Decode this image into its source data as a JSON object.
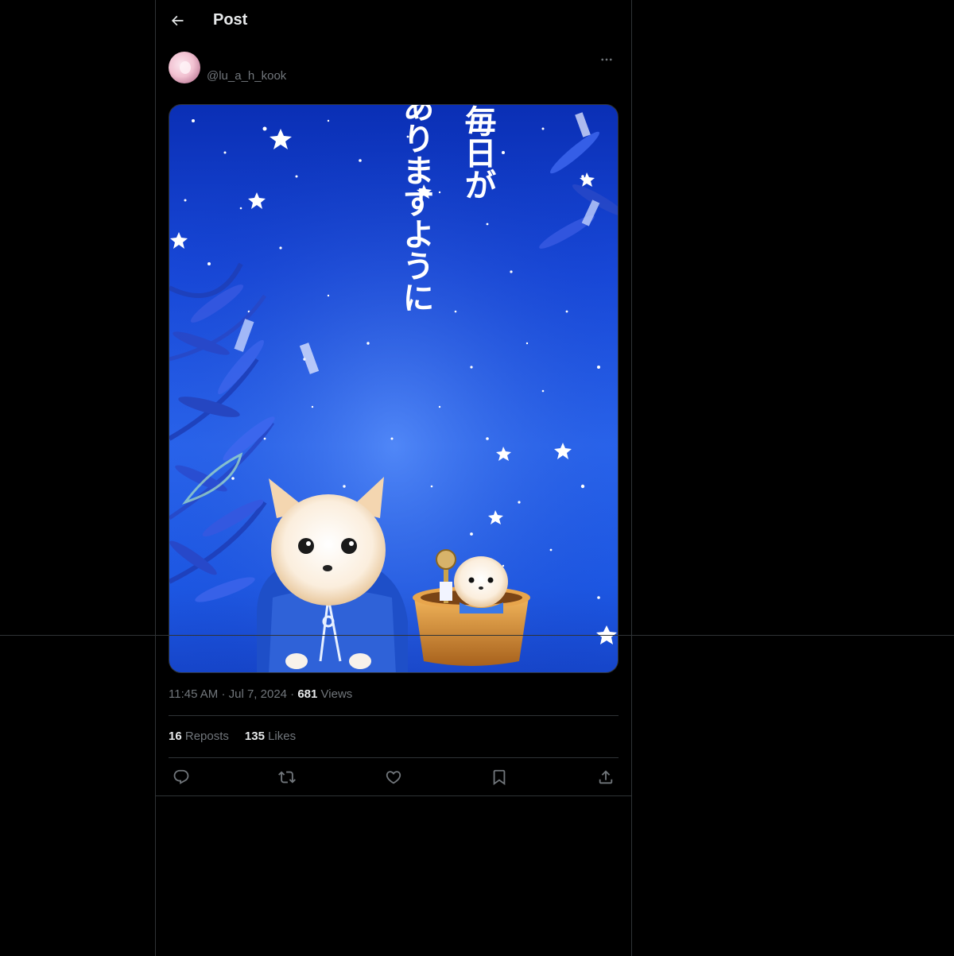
{
  "header": {
    "title": "Post",
    "back_icon": "arrow-left-icon"
  },
  "post": {
    "author": {
      "handle": "@lu_a_h_kook",
      "avatar_icon": "avatar-image"
    },
    "more_icon": "more-horizontal-icon",
    "media": {
      "text_lines": [
        "毎日が",
        "幸せでありますように"
      ],
      "colors": {
        "sky_top": "#0a2fb5",
        "sky_mid": "#2a66ee",
        "text": "#ffffff"
      }
    },
    "meta": {
      "time": "11:45 AM",
      "separator": "·",
      "date": "Jul 7, 2024",
      "views_count": "681",
      "views_label": "Views"
    },
    "stats": {
      "reposts_count": "16",
      "reposts_label": "Reposts",
      "likes_count": "135",
      "likes_label": "Likes"
    },
    "actions": [
      {
        "name": "reply",
        "icon": "reply-icon"
      },
      {
        "name": "repost",
        "icon": "repost-icon"
      },
      {
        "name": "like",
        "icon": "heart-icon"
      },
      {
        "name": "bookmark",
        "icon": "bookmark-icon"
      },
      {
        "name": "share",
        "icon": "share-icon"
      }
    ]
  },
  "colors": {
    "background": "#000000",
    "border": "#2f3336",
    "text_primary": "#e7e9ea",
    "text_secondary": "#71767b"
  }
}
